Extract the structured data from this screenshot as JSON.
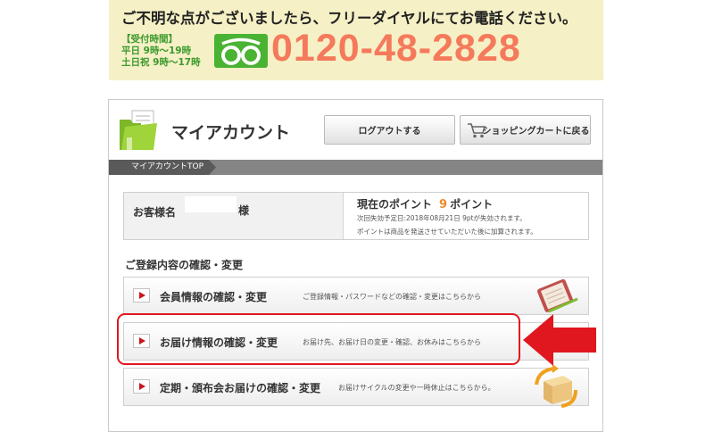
{
  "banner": {
    "title": "ご不明な点がございましたら、フリーダイヤルにてお電話ください。",
    "hours_heading": "【受付時間】",
    "hours_weekday": "平日 9時～19時",
    "hours_weekend": "土日祝 9時～17時",
    "phone": "0120-48-2828"
  },
  "header": {
    "title": "マイアカウント",
    "logout_label": "ログアウトする",
    "cart_label": "ショッピングカートに戻る"
  },
  "breadcrumb": {
    "current": "マイアカウントTOP"
  },
  "account": {
    "customer_label": "お客様名",
    "honorific": "様",
    "points_label": "現在のポイント",
    "points_value": "9",
    "points_unit": "ポイント",
    "points_expiry": "次回失効予定日:2018年08月21日 9ptが失効されます。",
    "points_note": "ポイントは商品を発送させていただいた後に加算されます。"
  },
  "registration": {
    "heading": "ご登録内容の確認・変更",
    "items": [
      {
        "title": "会員情報の確認・変更",
        "desc": "ご登録情報・パスワードなどの確認・変更はこちらから",
        "icon": "notebook-icon"
      },
      {
        "title": "お届け情報の確認・変更",
        "desc": "お届け先、お届け日の変更・確認、お休みはこちらから",
        "icon": "delivery-icon"
      },
      {
        "title": "定期・頒布会お届けの確認・変更",
        "desc": "お届けサイクルの変更や一時休止はこちらから。",
        "icon": "cycle-box-icon"
      }
    ]
  },
  "colors": {
    "banner_bg": "#f6f0c6",
    "phone": "#f47a5b",
    "hours": "#3a9a2c",
    "points": "#f08a2e",
    "highlight": "#e0171f"
  }
}
